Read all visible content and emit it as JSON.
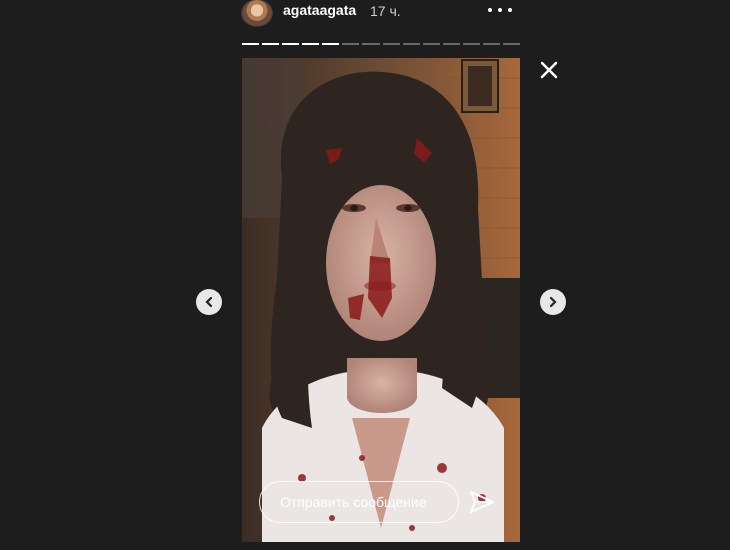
{
  "header": {
    "username": "agataagata",
    "timestamp": "17 ч."
  },
  "progress": {
    "total_segments": 14,
    "completed_segments": 5
  },
  "story": {
    "reply_placeholder": "Отправить сообщение"
  },
  "icons": {
    "more": "more-dots-icon",
    "close": "close-icon",
    "prev": "chevron-left-icon",
    "next": "chevron-right-icon",
    "send": "send-icon"
  }
}
